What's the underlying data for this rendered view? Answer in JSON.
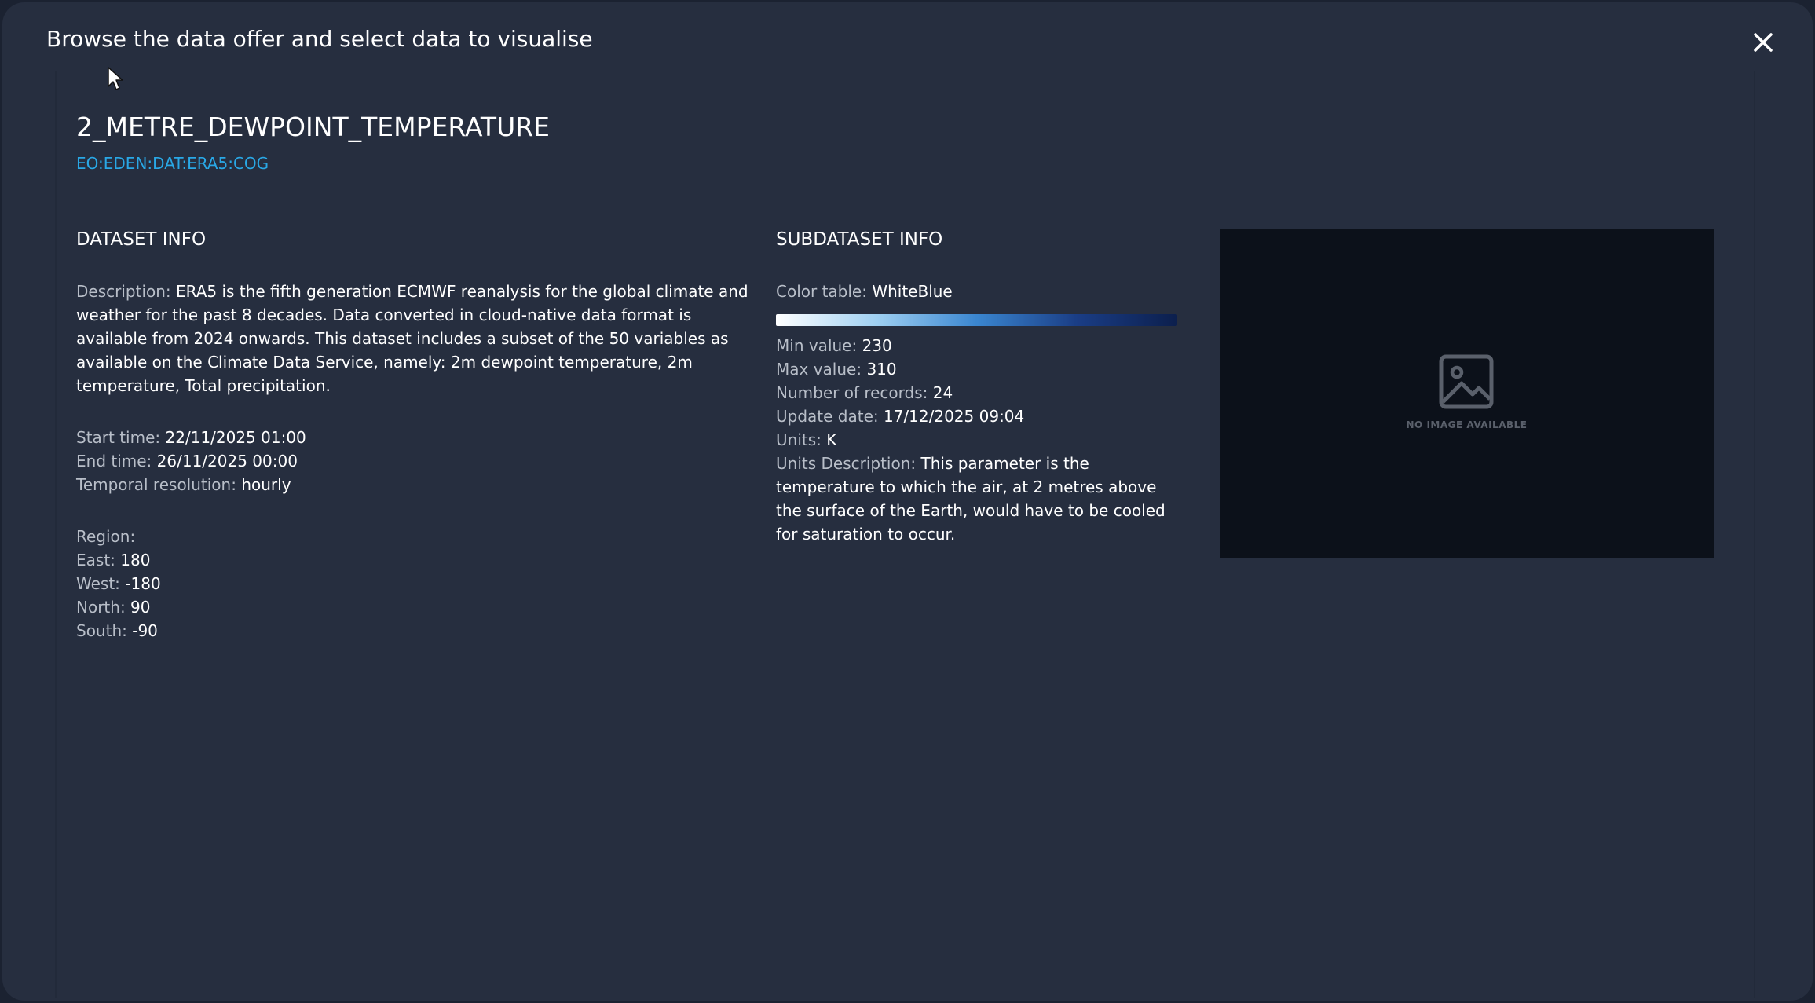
{
  "modal": {
    "title": "Browse the data offer and select data to visualise",
    "close_icon": "close-x-icon"
  },
  "dataset": {
    "name": "2_METRE_DEWPOINT_TEMPERATURE",
    "id": "EO:EDEN:DAT:ERA5:COG"
  },
  "dataset_info": {
    "heading": "DATASET INFO",
    "description_label": "Description:",
    "description": "ERA5 is the fifth generation ECMWF reanalysis for the global climate and weather for the past 8 decades. Data converted in cloud-native data format is available from 2024 onwards. This dataset includes a subset of the 50 variables as available on the Climate Data Service, namely: 2m dewpoint temperature, 2m temperature, Total precipitation.",
    "start_time_label": "Start time:",
    "start_time": "22/11/2025 01:00",
    "end_time_label": "End time:",
    "end_time": "26/11/2025 00:00",
    "temporal_resolution_label": "Temporal resolution:",
    "temporal_resolution": "hourly",
    "region_label": "Region:",
    "east_label": "East:",
    "east": "180",
    "west_label": "West:",
    "west": "-180",
    "north_label": "North:",
    "north": "90",
    "south_label": "South:",
    "south": "-90"
  },
  "subdataset_info": {
    "heading": "SUBDATASET INFO",
    "color_table_label": "Color table:",
    "color_table": "WhiteBlue",
    "colorbar_colors": [
      "#ffffff",
      "#9fd0f2",
      "#3a86d0",
      "#1a3d85",
      "#0c1f4d"
    ],
    "min_value_label": "Min value:",
    "min_value": "230",
    "max_value_label": "Max value:",
    "max_value": "310",
    "records_label": "Number of records:",
    "records": "24",
    "update_date_label": "Update date:",
    "update_date": "17/12/2025 09:04",
    "units_label": "Units:",
    "units": "K",
    "units_description_label": "Units Description:",
    "units_description": "This parameter is the temperature to which the air, at 2 metres above the surface of the Earth, would have to be cooled for saturation to occur."
  },
  "thumbnail": {
    "icon": "image-placeholder-icon",
    "text": "NO IMAGE AVAILABLE"
  },
  "colors": {
    "background": "#1b2231",
    "modal": "#262e3f",
    "accent_link": "#29a8e6",
    "thumbnail_bg": "#0c111a"
  }
}
